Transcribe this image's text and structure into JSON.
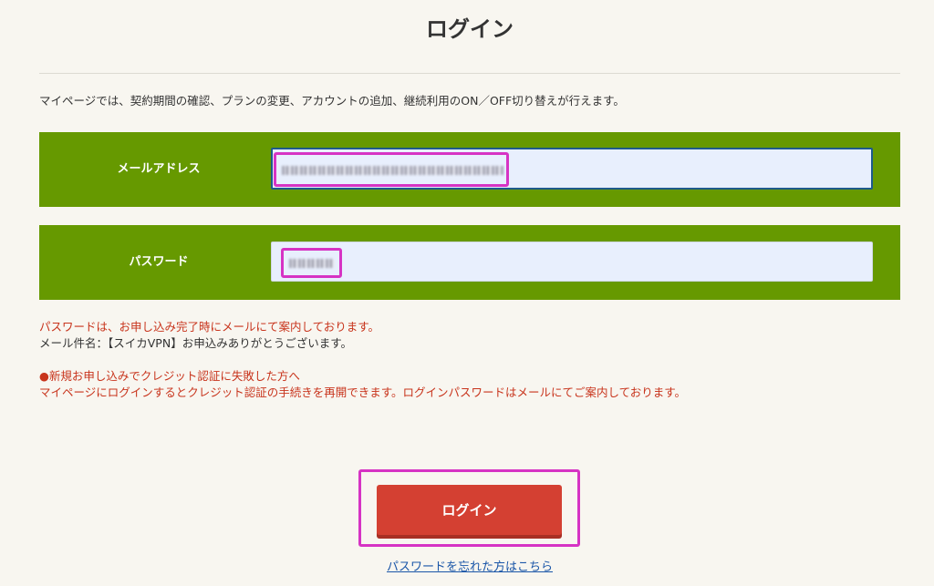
{
  "page": {
    "title": "ログイン",
    "intro": "マイページでは、契約期間の確認、プランの変更、アカウントの追加、継続利用のON／OFF切り替えが行えます。"
  },
  "form": {
    "email_label": "メールアドレス",
    "password_label": "パスワード"
  },
  "notes": {
    "password_info": "パスワードは、お申し込み完了時にメールにて案内しております。",
    "email_subject": "メール件名：【スイカVPN】お申込みありがとうございます。",
    "credit_heading": "●新規お申し込みでクレジット認証に失敗した方へ",
    "credit_body": "マイページにログインするとクレジット認証の手続きを再開できます。ログインパスワードはメールにてご案内しております。"
  },
  "actions": {
    "login_label": "ログイン",
    "forgot_password": "パスワードを忘れた方はこちら"
  },
  "colors": {
    "form_row": "#669900",
    "login_button": "#d44032",
    "note_red": "#c8341c",
    "highlight": "#d633c4",
    "link": "#1a56a8"
  }
}
